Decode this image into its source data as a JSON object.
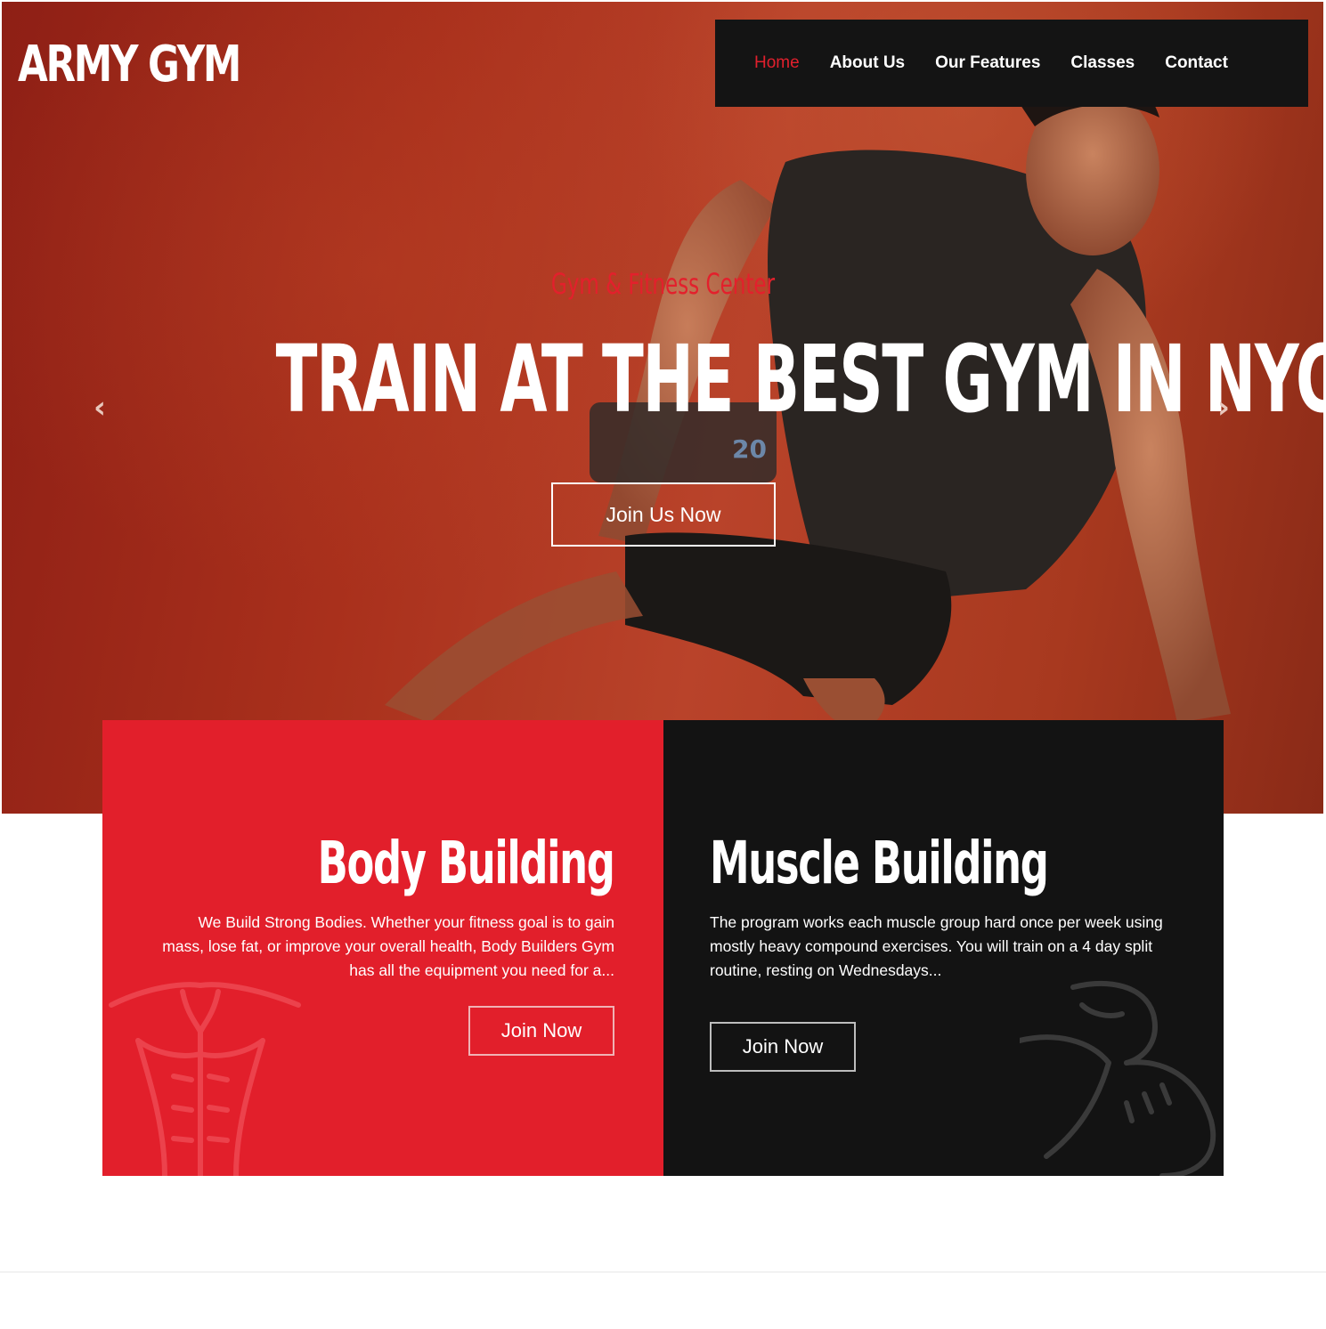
{
  "brand": {
    "logo_text": "ARMY GYM"
  },
  "nav": {
    "items": [
      {
        "label": "Home",
        "active": true
      },
      {
        "label": "About Us",
        "active": false
      },
      {
        "label": "Our Features",
        "active": false
      },
      {
        "label": "Classes",
        "active": false
      },
      {
        "label": "Contact",
        "active": false
      }
    ]
  },
  "hero": {
    "subtitle": "Gym & Fitness Center",
    "headline": "TRAIN AT THE BEST GYM IN NYC",
    "cta_label": "Join Us Now",
    "prev_icon": "chevron-left-icon",
    "next_icon": "chevron-right-icon",
    "prev_glyph": "‹",
    "next_glyph": "›"
  },
  "cards": [
    {
      "title": "Body Building",
      "text": "We Build Strong Bodies. Whether your fitness goal is to gain mass, lose fat, or improve your overall health, Body Builders Gym has all the equipment you need for a...",
      "button_label": "Join Now",
      "icon": "torso-icon"
    },
    {
      "title": "Muscle Building",
      "text": "The program works each muscle group hard once per week using mostly heavy compound exercises. You will train on a 4 day split routine, resting on Wednesdays...",
      "button_label": "Join Now",
      "icon": "flexed-bicep-icon"
    }
  ],
  "colors": {
    "accent_red": "#e21f2b",
    "dark": "#131313",
    "hero_red": "#a9301c",
    "nav_bg": "#141414"
  }
}
